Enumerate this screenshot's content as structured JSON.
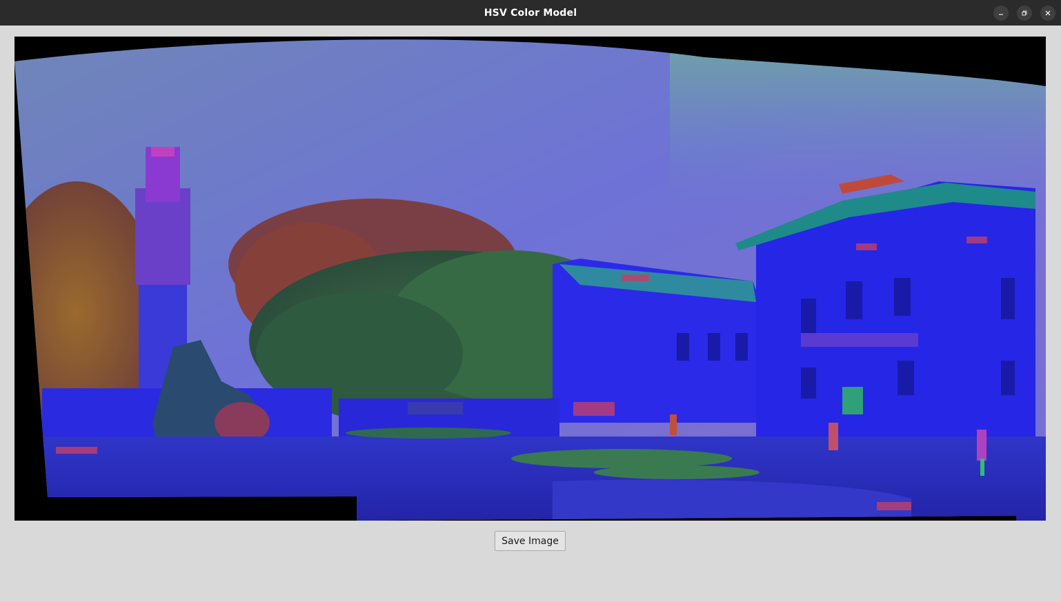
{
  "window": {
    "title": "HSV Color Model",
    "controls": {
      "minimize_icon": "minimize-icon",
      "maximize_icon": "restore-icon",
      "close_icon": "close-icon"
    }
  },
  "main": {
    "image": {
      "description_icon": "hsv-converted-panorama-image",
      "colors": {
        "sky": "#6f6fd8",
        "sky_top": "#6e8fb4",
        "building": "#2a2ae0",
        "trees": "#2f5a3a",
        "foliage_red": "#8a3c3c",
        "ground": "#2727b8",
        "background": "#000000"
      }
    },
    "save_button_label": "Save Image"
  },
  "theme": {
    "window_bg": "#d9d9d9",
    "titlebar_bg": "#2b2b2b"
  }
}
